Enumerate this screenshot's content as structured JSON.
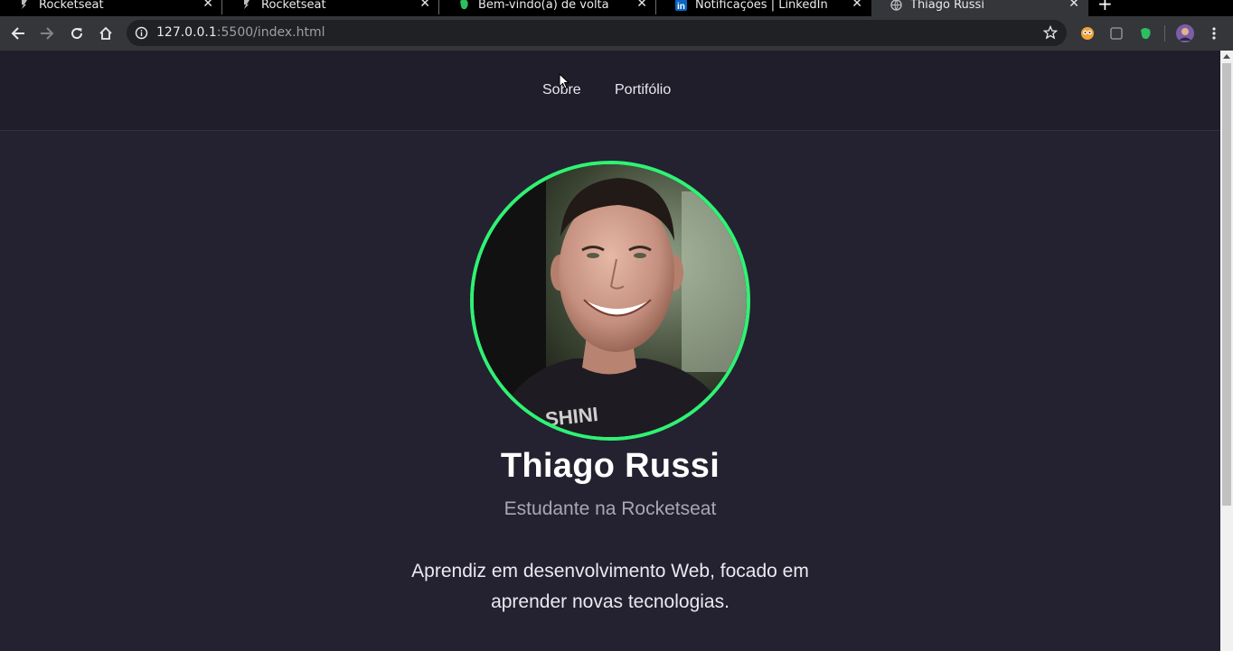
{
  "browser": {
    "tabs": [
      {
        "title": "Rocketseat",
        "favicon": "rocketseat-icon",
        "active": false
      },
      {
        "title": "Rocketseat",
        "favicon": "rocketseat-icon",
        "active": false
      },
      {
        "title": "Bem-vindo(a) de volta",
        "favicon": "evernote-icon",
        "active": false
      },
      {
        "title": "Notificações | LinkedIn",
        "favicon": "linkedin-icon",
        "active": false
      },
      {
        "title": "Thiago Russi",
        "favicon": "globe-icon",
        "active": true
      }
    ],
    "new_tab": "+",
    "tab_close": "✕",
    "address": {
      "host": "127.0.0.1",
      "path": ":5500/index.html"
    },
    "accent_green": "#2ff274"
  },
  "page": {
    "nav": {
      "sobre": "Sobre",
      "portfolio": "Portifólio"
    },
    "profile": {
      "name": "Thiago Russi",
      "subtitle": "Estudante na Rocketseat",
      "bio": "Aprendiz em desenvolvimento Web, focado em aprender novas tecnologias."
    },
    "colors": {
      "background": "#242130",
      "header": "#211e2c",
      "avatar_border": "#2ff274",
      "subtitle": "#a9a6b5"
    }
  }
}
